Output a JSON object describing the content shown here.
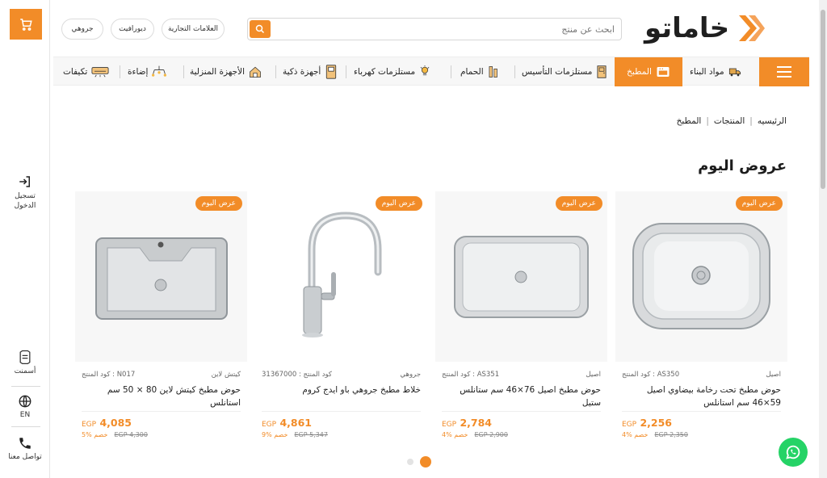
{
  "brand": {
    "logo_text": "خاماتو",
    "accent": "#f28c28"
  },
  "header": {
    "search_placeholder": "ابحث عن منتج",
    "brand_pills": [
      "العلامات التجارية",
      "ديورافيت",
      "جروهي"
    ]
  },
  "rail": {
    "login_label": "تسجيل الدخول",
    "cement_label": "أسمنت",
    "lang_label": "EN",
    "contact_label": "تواصل معنا"
  },
  "nav": {
    "items": [
      {
        "label": "مواد البناء",
        "icon": "truck-icon"
      },
      {
        "label": "المطبخ",
        "icon": "oven-icon",
        "active": true
      },
      {
        "label": "مستلزمات التأسيس",
        "icon": "door-icon"
      },
      {
        "label": "الحمام",
        "icon": "shower-icon"
      },
      {
        "label": "مستلزمات كهرباء",
        "icon": "bulb-icon"
      },
      {
        "label": "أجهزة ذكية",
        "icon": "smart-panel-icon"
      },
      {
        "label": "الأجهزة المنزلية",
        "icon": "home-appliance-icon"
      },
      {
        "label": "إضاءة",
        "icon": "lamp-icon"
      },
      {
        "label": "تكيفات",
        "icon": "air-conditioner-icon"
      }
    ]
  },
  "breadcrumb": {
    "home": "الرئيسيه",
    "products": "المنتجات",
    "current": "المطبخ"
  },
  "section_title": "عروض اليوم",
  "products": [
    {
      "badge": "عرض اليوم",
      "brand": "اصيل",
      "code": "كود المنتج : AS350",
      "name": "حوض مطبخ تحت رخامة بيضاوي اصيل 59×46 سم استانلس",
      "price": "2,256",
      "currency": "EGP",
      "old_price": "EGP 2,350",
      "discount": "4% خصم",
      "image": "oval-sink"
    },
    {
      "badge": "عرض اليوم",
      "brand": "اصيل",
      "code": "كود المنتج : AS351",
      "name": "حوض مطبخ اصيل 76×46 سم ستانلس ستيل",
      "price": "2,784",
      "currency": "EGP",
      "old_price": "EGP 2,900",
      "discount": "4% خصم",
      "image": "rect-sink"
    },
    {
      "badge": "عرض اليوم",
      "brand": "جروهي",
      "code": "كود المنتج : 31367000",
      "name": "خلاط مطبخ جروهي باو ايدج كروم",
      "price": "4,861",
      "currency": "EGP",
      "old_price": "EGP 5,347",
      "discount": "9% خصم",
      "image": "faucet"
    },
    {
      "badge": "عرض اليوم",
      "brand": "كيتش لاين",
      "code": "كود المنتج : N017",
      "name": "حوض مطبخ كيتش لاين 80 × 50 سم استانلس",
      "price": "4,085",
      "currency": "EGP",
      "old_price": "EGP 4,300",
      "discount": "5% خصم",
      "image": "deep-sink"
    }
  ]
}
